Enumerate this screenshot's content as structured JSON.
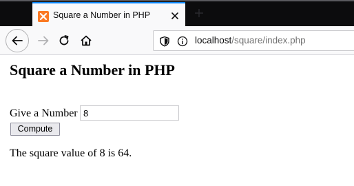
{
  "browser": {
    "tab": {
      "title": "Square a Number in PHP",
      "favicon": "xampp-icon"
    },
    "url": {
      "host": "localhost",
      "path": "/square/index.php"
    },
    "colors": {
      "tabstrip": "#0c0c0d",
      "tab_active_line": "#0a84ff",
      "favicon_bg": "#fb7a24"
    }
  },
  "page": {
    "heading": "Square a Number in PHP",
    "form": {
      "label": "Give a Number",
      "input_value": "8",
      "submit_label": "Compute"
    },
    "result": "The square value of 8 is 64."
  }
}
